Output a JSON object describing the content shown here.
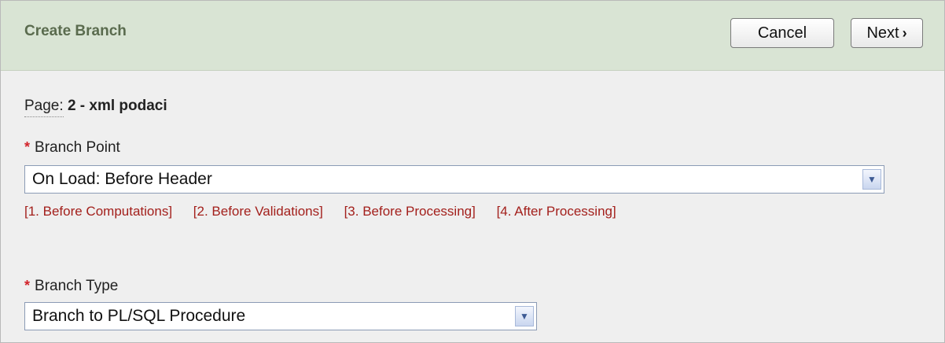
{
  "header": {
    "title": "Create Branch",
    "cancel_label": "Cancel",
    "next_label": "Next"
  },
  "page": {
    "label": "Page:",
    "value": "2 - xml podaci"
  },
  "branch_point": {
    "required_marker": "*",
    "label": "Branch Point",
    "selected": "On Load: Before Header",
    "quick_links": [
      "[1. Before Computations]",
      "[2. Before Validations]",
      "[3. Before Processing]",
      "[4. After Processing]"
    ]
  },
  "branch_type": {
    "required_marker": "*",
    "label": "Branch Type",
    "selected": "Branch to PL/SQL Procedure"
  },
  "icons": {
    "next": "chevron-right-icon",
    "dropdown": "chevron-down-icon"
  },
  "colors": {
    "header_bg": "#d9e4d4",
    "header_title": "#5a6b4e",
    "required": "#d2232a",
    "link": "#a3201c"
  }
}
